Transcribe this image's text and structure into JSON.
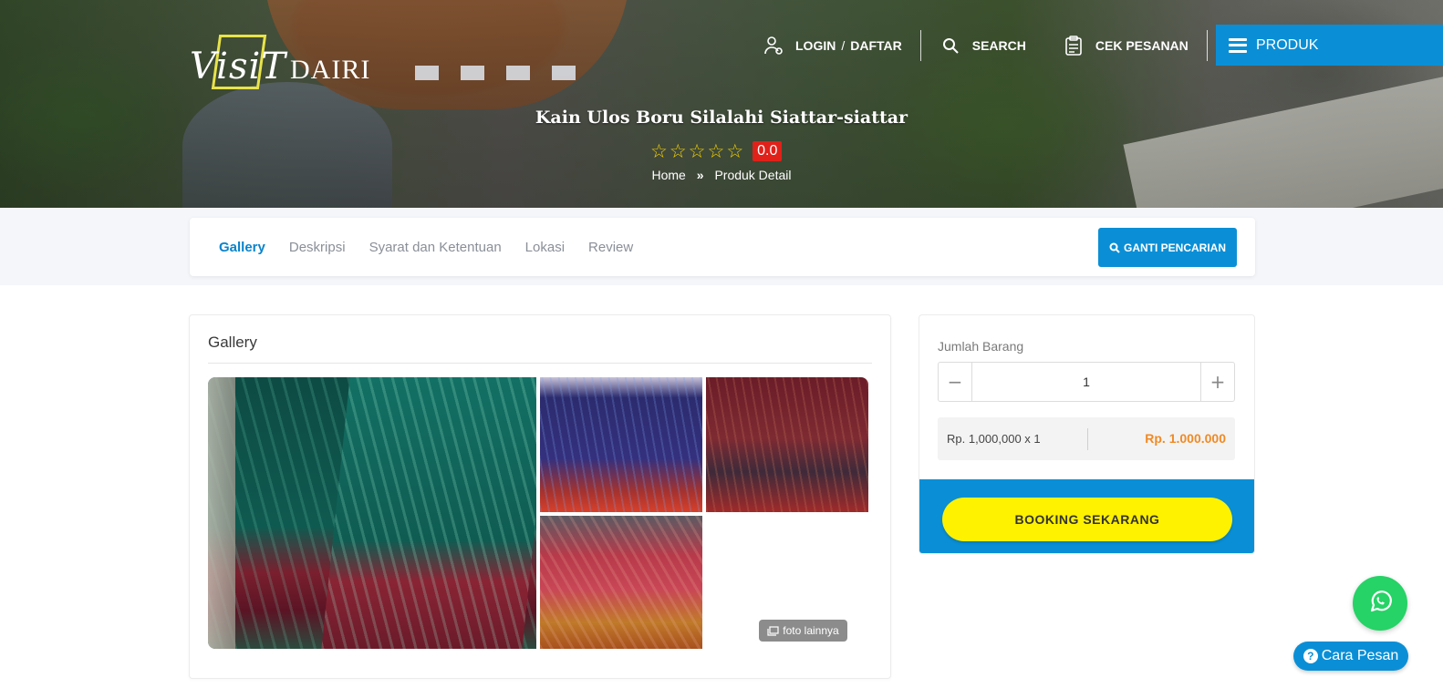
{
  "brand": {
    "script": "VisiT",
    "name": "DAIRI",
    "accent_color": "#e8e34a"
  },
  "topnav": {
    "login": "LOGIN",
    "slash": "/",
    "daftar": "DAFTAR",
    "search": "SEARCH",
    "cek_pesanan": "CEK PESANAN",
    "produk": "PRODUK"
  },
  "product": {
    "title": "Kain Ulos Boru Silalahi Siattar-siattar",
    "rating_stars": 0,
    "max_stars": 5,
    "rating_score": "0.0"
  },
  "breadcrumb": {
    "home": "Home",
    "separator": "»",
    "current": "Produk Detail"
  },
  "tabs": [
    {
      "label": "Gallery",
      "active": true
    },
    {
      "label": "Deskripsi",
      "active": false
    },
    {
      "label": "Syarat dan Ketentuan",
      "active": false
    },
    {
      "label": "Lokasi",
      "active": false
    },
    {
      "label": "Review",
      "active": false
    }
  ],
  "search_change": {
    "label": "GANTI PENCARIAN"
  },
  "gallery": {
    "title": "Gallery",
    "more_label": "foto lainnya",
    "photo_count": 4
  },
  "booking": {
    "qty_label": "Jumlah Barang",
    "qty_value": "1",
    "minus": "−",
    "plus": "+",
    "calc": "Rp. 1,000,000 x 1",
    "total": "Rp. 1.000.000",
    "button": "BOOKING SEKARANG"
  },
  "floating": {
    "help_label": "Cara Pesan",
    "help_icon": "?"
  },
  "colors": {
    "primary": "#0a8fd6",
    "booking_button": "#fff200",
    "price": "#f08a24",
    "rating_badge": "#e0211a",
    "whatsapp": "#25d366"
  }
}
